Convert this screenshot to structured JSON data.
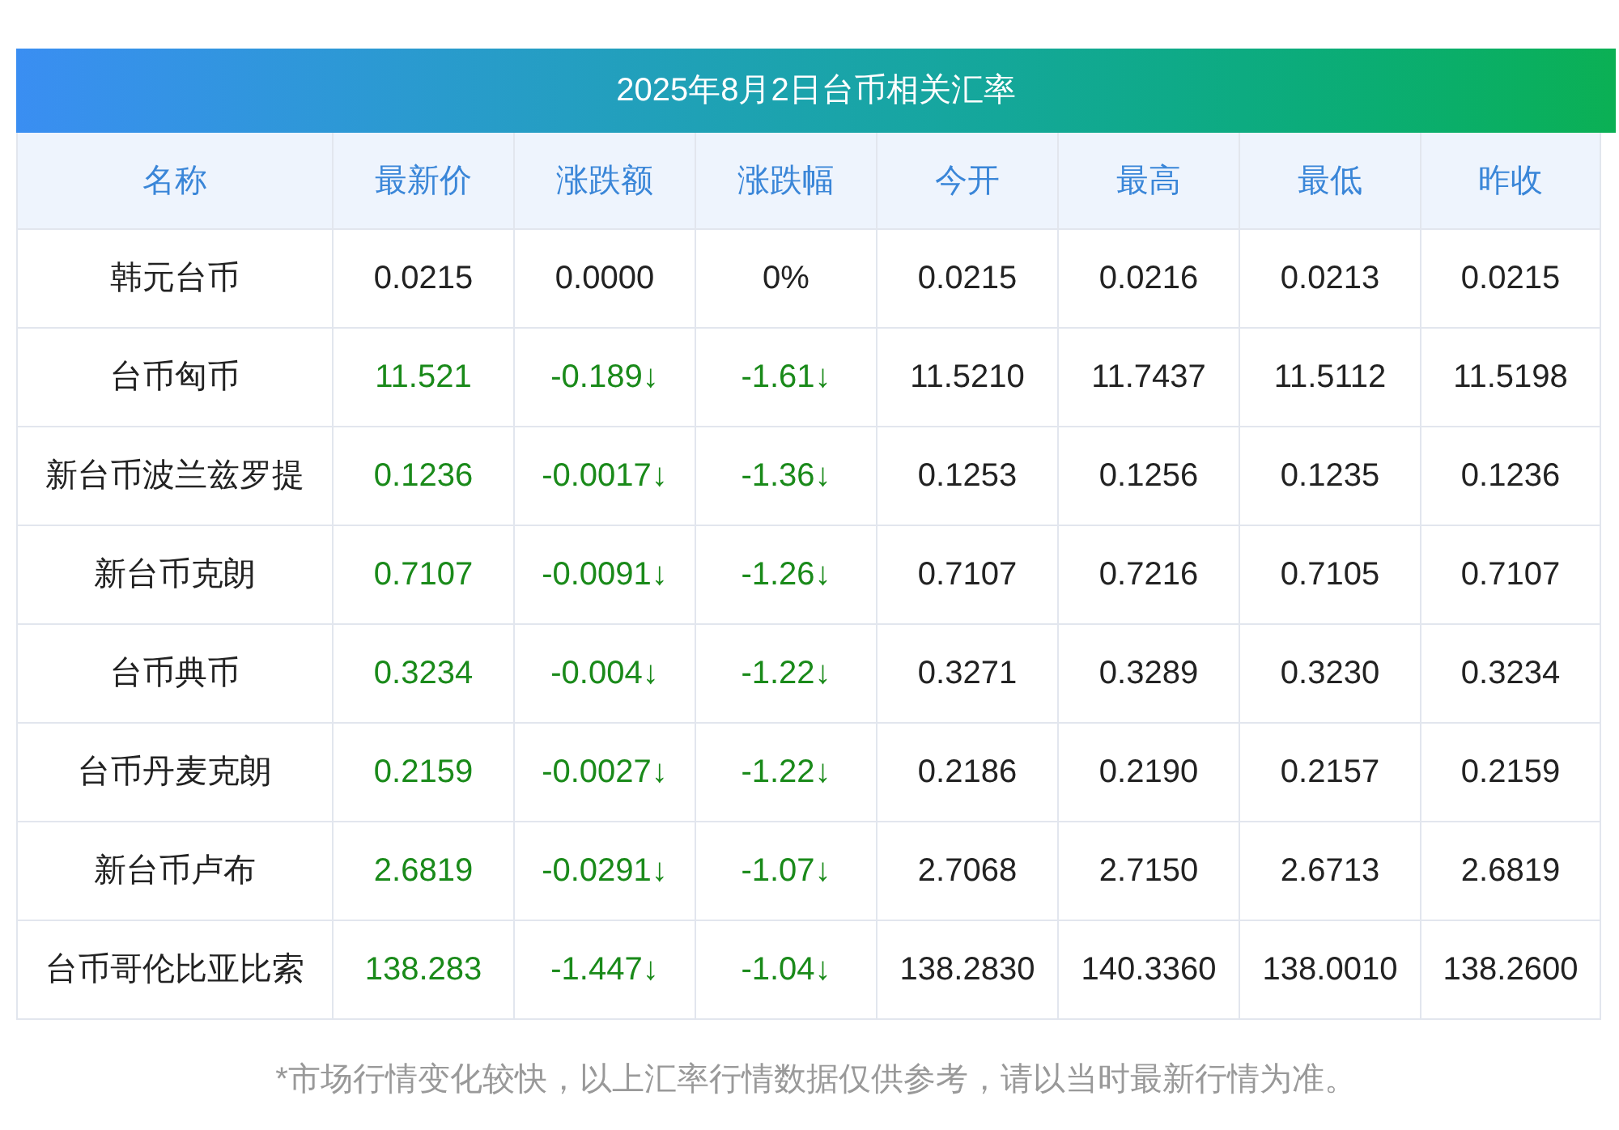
{
  "title": "2025年8月2日台币相关汇率",
  "columns": [
    "名称",
    "最新价",
    "涨跌额",
    "涨跌幅",
    "今开",
    "最高",
    "最低",
    "昨收"
  ],
  "rows": [
    {
      "color": "#222222",
      "cells": [
        "韩元台币",
        "0.0215",
        "0.0000",
        "0%",
        "0.0215",
        "0.0216",
        "0.0213",
        "0.0215"
      ]
    },
    {
      "color": "#1a8a1a",
      "cells": [
        "台币匈币",
        "11.521",
        "-0.189↓",
        "-1.61↓",
        "11.5210",
        "11.7437",
        "11.5112",
        "11.5198"
      ]
    },
    {
      "color": "#1a8a1a",
      "cells": [
        "新台币波兰兹罗提",
        "0.1236",
        "-0.0017↓",
        "-1.36↓",
        "0.1253",
        "0.1256",
        "0.1235",
        "0.1236"
      ]
    },
    {
      "color": "#1a8a1a",
      "cells": [
        "新台币克朗",
        "0.7107",
        "-0.0091↓",
        "-1.26↓",
        "0.7107",
        "0.7216",
        "0.7105",
        "0.7107"
      ]
    },
    {
      "color": "#1a8a1a",
      "cells": [
        "台币典币",
        "0.3234",
        "-0.004↓",
        "-1.22↓",
        "0.3271",
        "0.3289",
        "0.3230",
        "0.3234"
      ]
    },
    {
      "color": "#1a8a1a",
      "cells": [
        "台币丹麦克朗",
        "0.2159",
        "-0.0027↓",
        "-1.22↓",
        "0.2186",
        "0.2190",
        "0.2157",
        "0.2159"
      ]
    },
    {
      "color": "#1a8a1a",
      "cells": [
        "新台币卢布",
        "2.6819",
        "-0.0291↓",
        "-1.07↓",
        "2.7068",
        "2.7150",
        "2.6713",
        "2.6819"
      ]
    },
    {
      "color": "#1a8a1a",
      "cells": [
        "台币哥伦比亚比索",
        "138.283",
        "-1.447↓",
        "-1.04↓",
        "138.2830",
        "140.3360",
        "138.0010",
        "138.2600"
      ]
    }
  ],
  "note": "*市场行情变化较快，以上汇率行情数据仅供参考，请以当时最新行情为准。"
}
